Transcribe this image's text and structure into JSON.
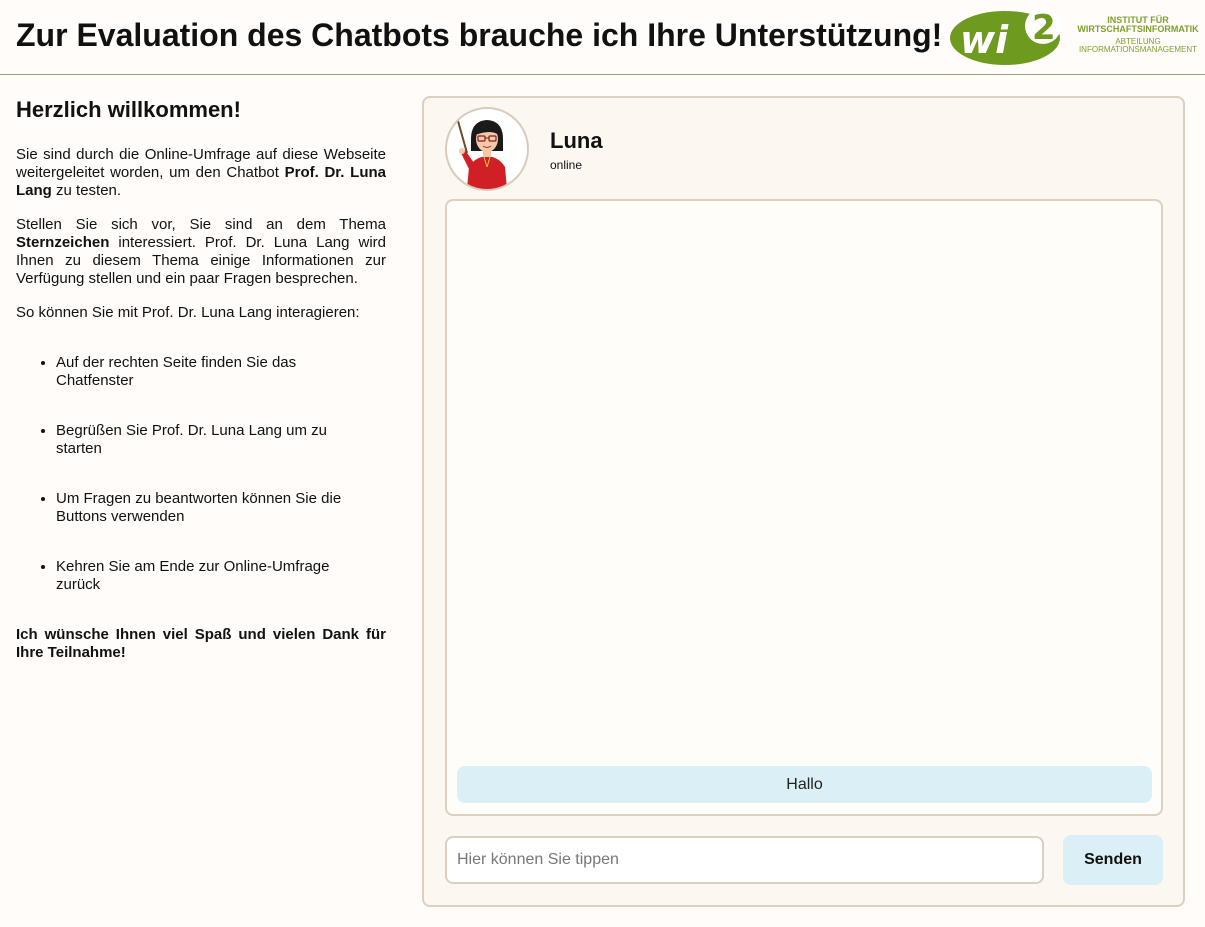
{
  "header": {
    "title": "Zur Evaluation des Chatbots brauche ich Ihre Unterstützung!",
    "logo_text": "wi2",
    "institute_line1": "INSTITUT FÜR",
    "institute_line2": "WIRTSCHAFTSINFORMATIK",
    "institute_line3": "ABTEILUNG",
    "institute_line4": "INFORMATIONSMANAGEMENT",
    "logo_color": "#6e9a1f"
  },
  "intro": {
    "heading": "Herzlich willkommen!",
    "p1_before": "Sie sind durch die Online-Umfrage auf diese Webseite weitergeleitet worden, um den Chatbot ",
    "p1_bold": "Prof. Dr. Luna Lang",
    "p1_after": " zu testen.",
    "p2_before": "Stellen Sie sich vor, Sie sind an dem Thema ",
    "p2_bold": "Sternzeichen",
    "p2_after": " interessiert. Prof. Dr. Luna Lang wird Ihnen zu diesem Thema einige Informationen zur Verfügung stellen und ein paar Fragen besprechen.",
    "p3": "So können Sie mit Prof. Dr. Luna Lang interagieren:",
    "steps": [
      "Auf der rechten Seite finden Sie das Chatfenster",
      "Begrüßen Sie Prof. Dr. Luna Lang um zu starten",
      "Um Fragen zu beantworten können Sie die Buttons verwenden",
      "Kehren Sie am Ende zur Online-Umfrage zurück"
    ],
    "closing": "Ich wünsche Ihnen viel Spaß und vielen Dank für Ihre Teilnahme!"
  },
  "chat": {
    "bot_name": "Luna",
    "status": "online",
    "avatar_icon": "teacher-avatar-icon",
    "quick_reply": "Hallo",
    "input_placeholder": "Hier können Sie tippen",
    "input_value": "",
    "send_label": "Senden",
    "accent_color": "#daeff6",
    "border_color": "#ddd0bf"
  }
}
